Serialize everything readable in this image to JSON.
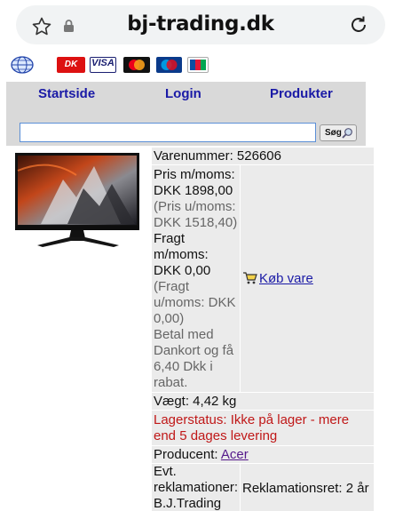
{
  "browser": {
    "url": "bj-trading.dk"
  },
  "payment_logos": {
    "dankort": "DK",
    "visa": "VISA",
    "mastercard": "MasterCard",
    "maestro": "Maestro",
    "jcb": "JCB"
  },
  "nav": {
    "home": "Startside",
    "login": "Login",
    "products": "Produkter"
  },
  "search": {
    "value": "",
    "button": "Søg"
  },
  "product": {
    "item_number": "Varenummer: 526606",
    "price_label": "Pris m/moms:",
    "price": "DKK 1898,00",
    "price_ex_vat": "(Pris u/moms: DKK 1518,40)",
    "shipping_label": "Fragt m/moms:",
    "shipping": "DKK 0,00",
    "shipping_ex_vat": "(Fragt u/moms: DKK 0,00)",
    "discount_note": "Betal med Dankort og få 6,40 Dkk i rabat.",
    "buy_label": "Køb vare",
    "weight": "Vægt: 4,42 kg",
    "stock_status": "Lagerstatus: Ikke på lager - mere end 5 dages levering",
    "producer_label": "Producent:",
    "producer": "Acer",
    "claims_label": "Evt. reklamationer: B.J.Trading",
    "claims_value": "Reklamationsret: 2 år"
  },
  "colors": {
    "nav_link": "#1a1aa6",
    "stock_red": "#c01818",
    "visited_link": "#551a8b",
    "table_bg": "#ebebeb",
    "nav_bg": "#d9d9d9"
  }
}
